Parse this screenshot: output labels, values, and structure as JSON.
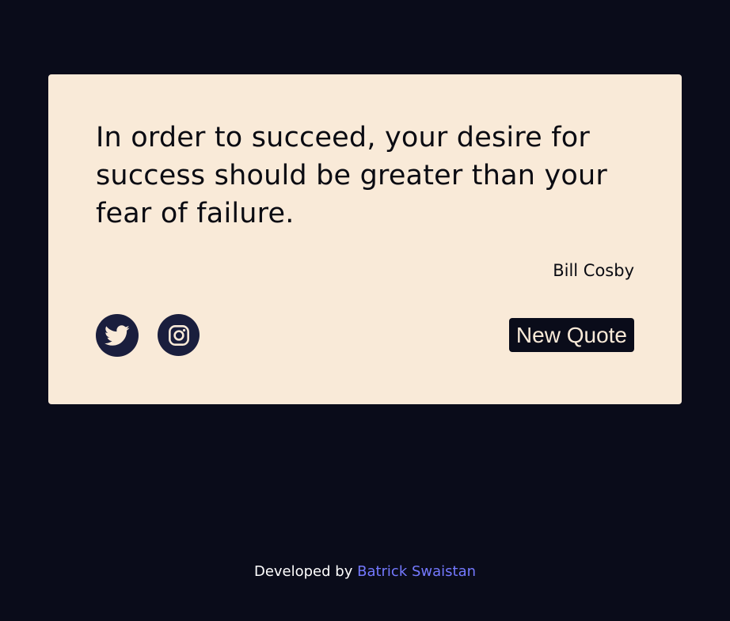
{
  "quote": {
    "text": "In order to succeed, your desire for success should be greater than your fear of failure.",
    "author": "Bill Cosby"
  },
  "actions": {
    "twitter_icon": "twitter-icon",
    "instagram_icon": "instagram-icon",
    "new_quote_label": "New Quote"
  },
  "footer": {
    "prefix": "Developed by",
    "author_link": "Batrick Swaistan"
  },
  "colors": {
    "background": "#0a0c1a",
    "card": "#f9ead8",
    "social_circle": "#1a1e3d",
    "link": "#7479ff"
  }
}
